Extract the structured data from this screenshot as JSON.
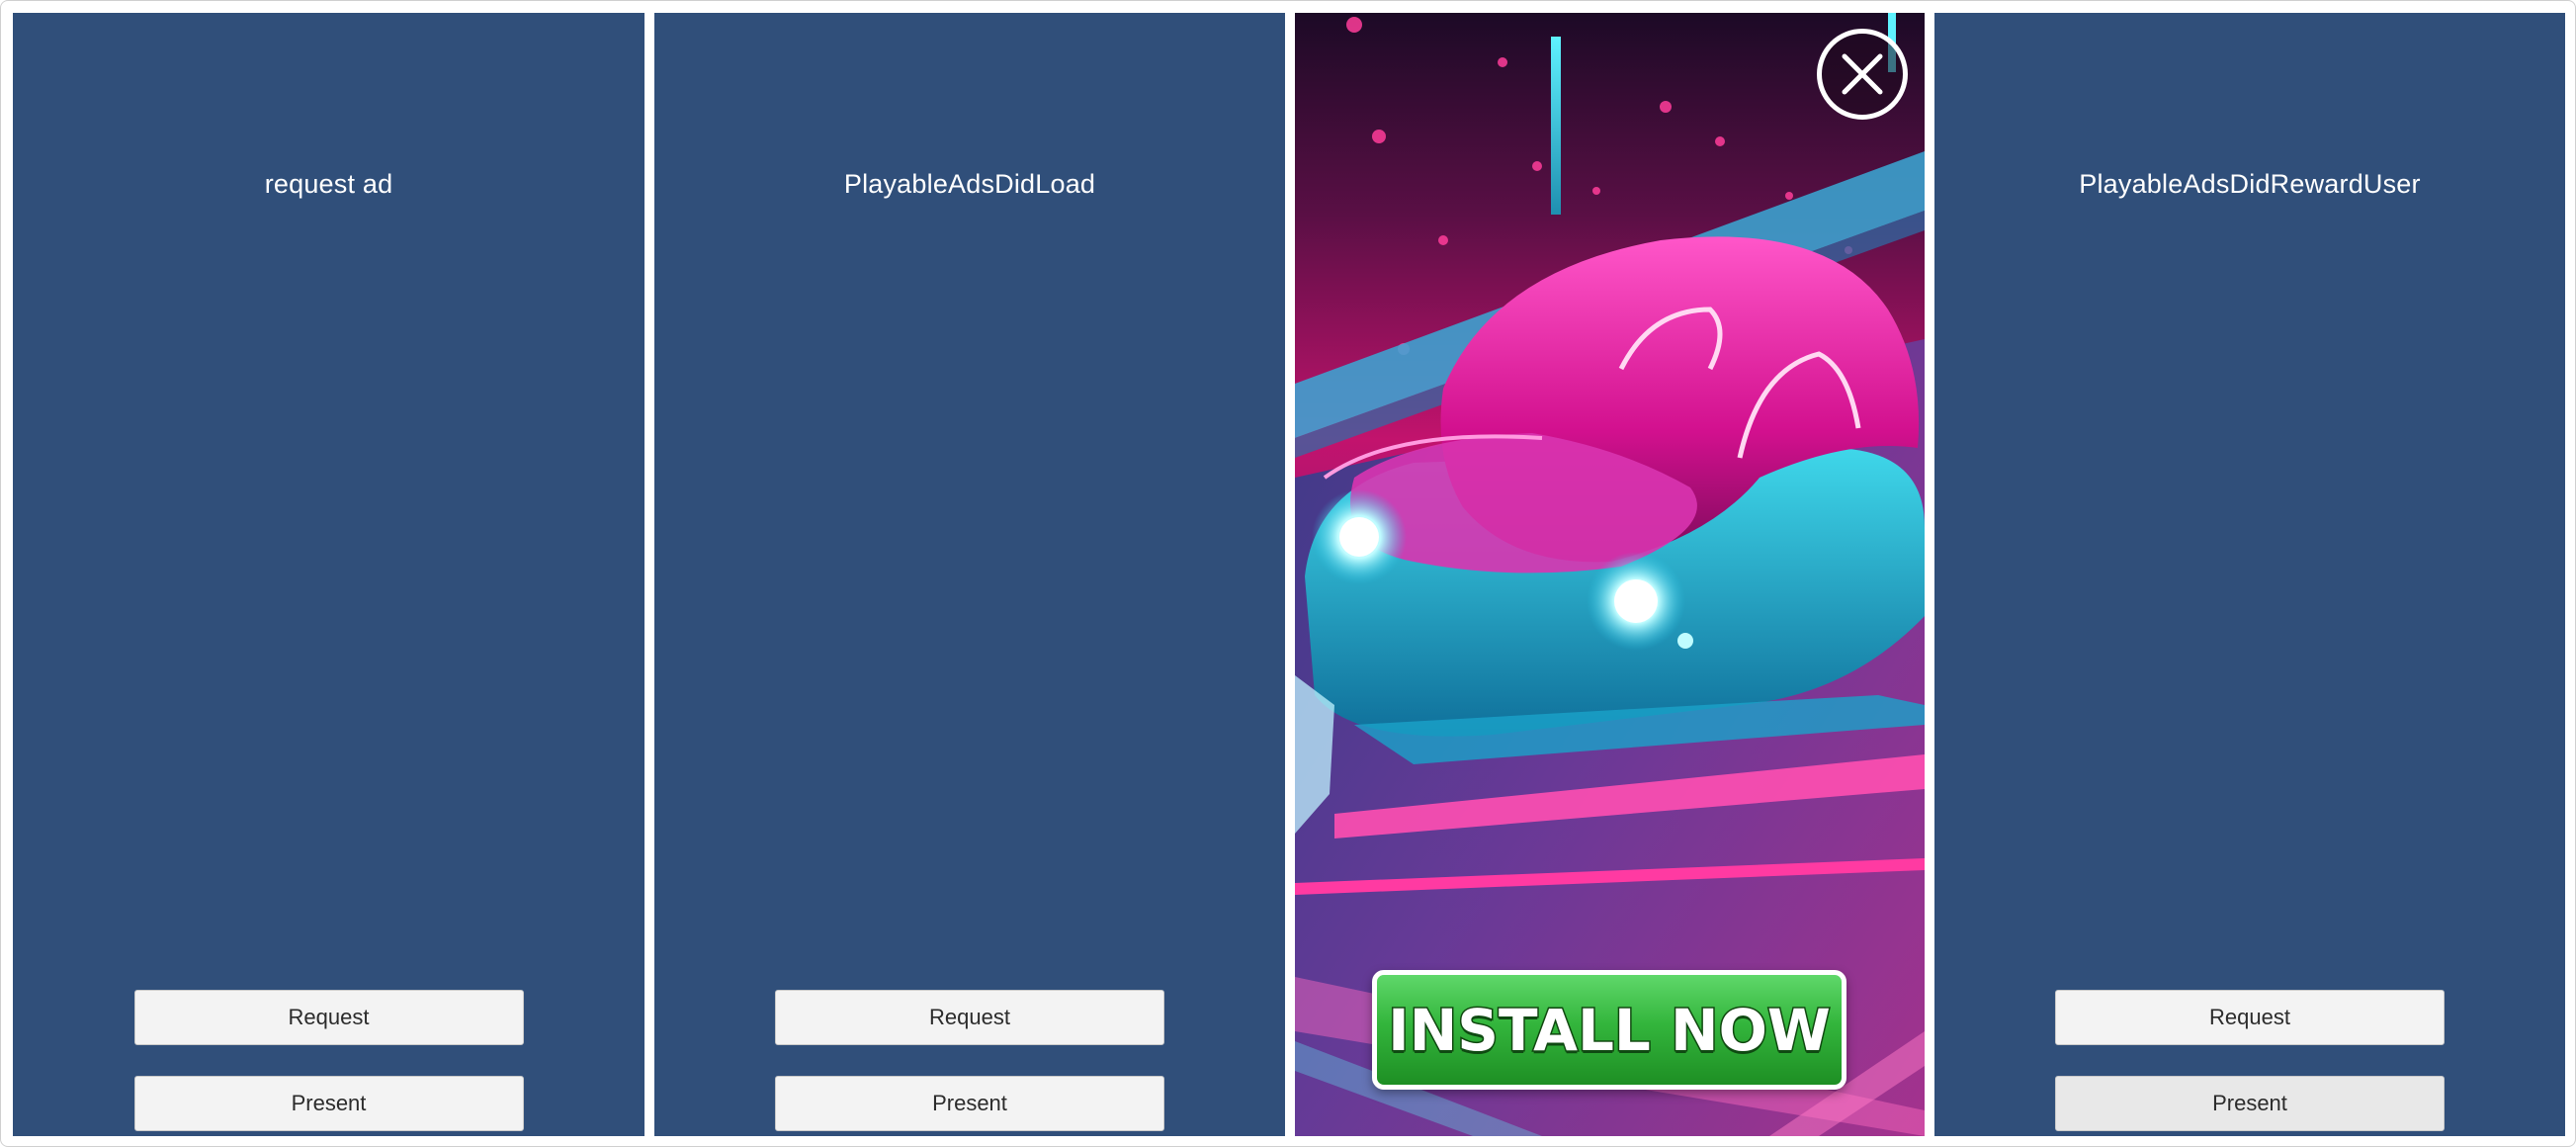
{
  "panels": [
    {
      "status": "request ad",
      "request_label": "Request",
      "present_label": "Present"
    },
    {
      "status": "PlayableAdsDidLoad",
      "request_label": "Request",
      "present_label": "Present"
    },
    {
      "ad": {
        "cta_label": "INSTALL NOW",
        "close_icon": "close-icon"
      }
    },
    {
      "status": "PlayableAdsDidRewardUser",
      "request_label": "Request",
      "present_label": "Present"
    }
  ],
  "colors": {
    "panel_background": "#304f7a",
    "button_background": "#f3f3f3",
    "cta_green": "#33b53c",
    "neon_pink": "#ff2fa8",
    "neon_cyan": "#3ee8f5"
  }
}
